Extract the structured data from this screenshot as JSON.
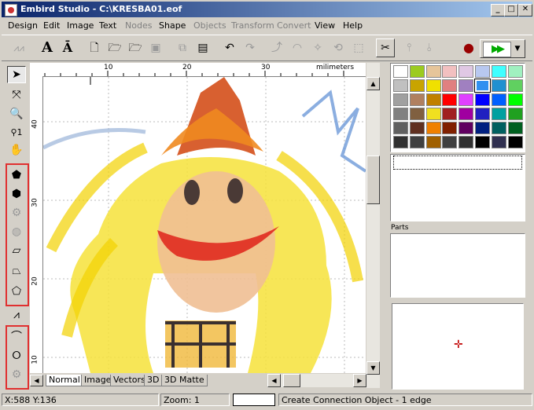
{
  "window": {
    "title": "Embird Studio - C:\\KRESBA01.eof"
  },
  "title_buttons": {
    "minimize": "_",
    "maximize": "□",
    "close": "✕"
  },
  "menu": [
    {
      "label": "Design",
      "enabled": true
    },
    {
      "label": "Edit",
      "enabled": true
    },
    {
      "label": "Image",
      "enabled": true
    },
    {
      "label": "Text",
      "enabled": true
    },
    {
      "label": "Nodes",
      "enabled": false
    },
    {
      "label": "Shape",
      "enabled": true
    },
    {
      "label": "Objects",
      "enabled": false
    },
    {
      "label": "Transform",
      "enabled": false
    },
    {
      "label": "Convert",
      "enabled": false
    },
    {
      "label": "View",
      "enabled": true
    },
    {
      "label": "Help",
      "enabled": true
    }
  ],
  "toolbar": {
    "icons": [
      "zigzag-stitch-icon",
      "text-icon",
      "text-outline-icon",
      "new-file-icon",
      "open-folder-icon",
      "open-folder-2-icon",
      "save-icon",
      "copy-icon",
      "paste-icon",
      "undo-icon",
      "redo-icon",
      "node-tool-icon",
      "arc-tool-icon",
      "shape-tool-icon",
      "transform-tool-icon",
      "resize-tool-icon",
      "sew-icon",
      "split-icon",
      "join-icon",
      "record-icon"
    ],
    "play_symbol": "▶▶",
    "dropdown_symbol": "▼"
  },
  "ruler": {
    "top_unit": "milimeters",
    "top_ticks": [
      "10",
      "20",
      "30"
    ],
    "left_ticks": [
      "40",
      "30",
      "20",
      "10"
    ]
  },
  "tabs": [
    "Normal",
    "Image",
    "Vectors",
    "3D",
    "3D Matte"
  ],
  "active_tab": "Normal",
  "panels": {
    "parts_label": "Parts"
  },
  "palette": {
    "colors": [
      [
        "#ffffff",
        "#9ccb1f",
        "#e6c59a",
        "#f2c0c0",
        "#e0c8e4",
        "#b8c8f0",
        "#40ffff",
        "#a0f0c0"
      ],
      [
        "#c0c0c0",
        "#c8a400",
        "#f0e000",
        "#e08080",
        "#a080c0",
        "#3090f0",
        "#2090d0",
        "#60d060"
      ],
      [
        "#a0a0a0",
        "#b08060",
        "#c08000",
        "#ff0000",
        "#e040ff",
        "#0000ff",
        "#0060ff",
        "#00ff00"
      ],
      [
        "#808080",
        "#806040",
        "#f0e020",
        "#a02020",
        "#a000a0",
        "#2020c0",
        "#00a0a0",
        "#20a020"
      ],
      [
        "#606060",
        "#603020",
        "#f08000",
        "#802000",
        "#600060",
        "#002080",
        "#006060",
        "#006020"
      ],
      [
        "#303030",
        "#404040",
        "#a06000",
        "#404040",
        "#303030",
        "#000000",
        "#303050",
        "#000000"
      ]
    ],
    "selected": [
      1,
      5
    ]
  },
  "status": {
    "coords": "X:588  Y:136",
    "zoom": "Zoom: 1",
    "message": "Create Connection Object - 1 edge"
  }
}
